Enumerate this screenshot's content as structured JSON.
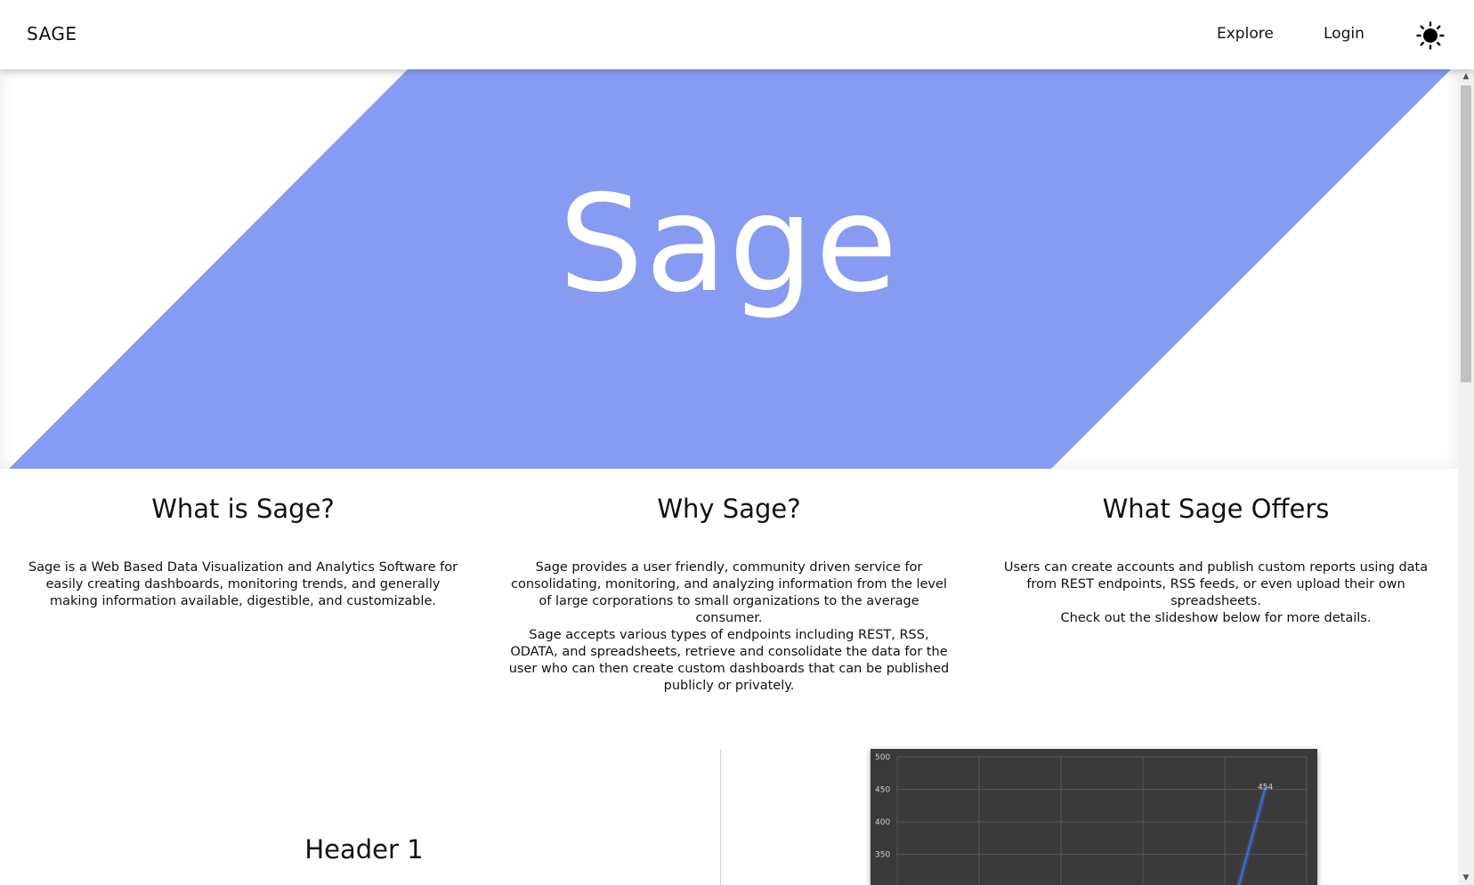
{
  "nav": {
    "brand": "SAGE",
    "explore": "Explore",
    "login": "Login",
    "theme_icon": "sun-icon"
  },
  "hero": {
    "title": "Sage",
    "accent_color": "#879bf2"
  },
  "columns": [
    {
      "heading": "What is Sage?",
      "body": "Sage is a Web Based Data Visualization and Analytics Software for easily creating dashboards, monitoring trends, and generally making information available, digestible, and customizable."
    },
    {
      "heading": "Why Sage?",
      "body": "Sage provides a user friendly, community driven service for consolidating, monitoring, and analyzing information from the level of large corporations to small organizations to the average consumer.\nSage accepts various types of endpoints including REST, RSS, ODATA, and spreadsheets, retrieve and consolidate the data for the user who can then create custom dashboards that can be published publicly or privately."
    },
    {
      "heading": "What Sage Offers",
      "body": "Users can create accounts and publish custom reports using data from REST endpoints, RSS feeds, or even upload their own spreadsheets.\nCheck out the slideshow below for more details."
    }
  ],
  "slideshow": {
    "header": "Header 1"
  },
  "chart_data": {
    "type": "line",
    "title": "",
    "xlabel": "",
    "ylabel": "",
    "y_ticks": [
      350,
      400,
      450,
      500
    ],
    "ylim": [
      300,
      500
    ],
    "visible_point_label": "454",
    "series": [
      {
        "values": [
          454
        ]
      }
    ],
    "line_color": "#3d6fd6",
    "background": "#3a3a3a",
    "grid": true
  }
}
